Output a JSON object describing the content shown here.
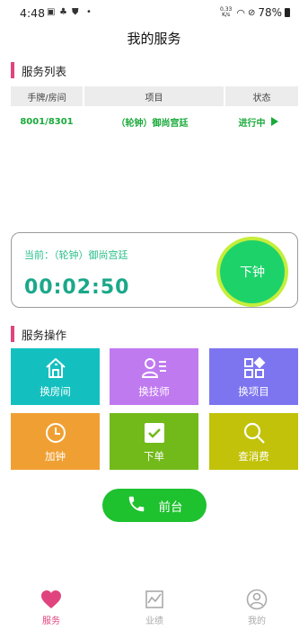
{
  "statusbar": {
    "time": "4:48",
    "speed_top": "0.33",
    "speed_bottom": "K/s",
    "battery": "78%"
  },
  "header": {
    "title": "我的服务"
  },
  "service_list": {
    "title": "服务列表",
    "columns": [
      "手牌/房间",
      "项目",
      "状态"
    ],
    "rows": [
      {
        "room": "8001/8301",
        "item": "（轮钟）御尚宫廷",
        "status": "进行中"
      }
    ]
  },
  "current": {
    "label": "当前：（轮钟）御尚宫廷",
    "timer": "00:02:50",
    "clockout_label": "下钟"
  },
  "operations": {
    "title": "服务操作",
    "tiles": [
      {
        "label": "换房间",
        "color": "#14c0bf",
        "icon": "house-icon"
      },
      {
        "label": "换技师",
        "color": "#c07af0",
        "icon": "person-list-icon"
      },
      {
        "label": "换项目",
        "color": "#7d75f0",
        "icon": "grid-icon"
      },
      {
        "label": "加钟",
        "color": "#f0a033",
        "icon": "clock-icon"
      },
      {
        "label": "下单",
        "color": "#72ba1a",
        "icon": "check-icon"
      },
      {
        "label": "查消费",
        "color": "#c2c20a",
        "icon": "search-icon"
      }
    ]
  },
  "frontdesk": {
    "label": "前台"
  },
  "bottom_nav": {
    "items": [
      {
        "label": "服务",
        "active": true
      },
      {
        "label": "业绩",
        "active": false
      },
      {
        "label": "我的",
        "active": false
      }
    ],
    "active_color": "#e0447e",
    "inactive_color": "#aaaaaa"
  }
}
